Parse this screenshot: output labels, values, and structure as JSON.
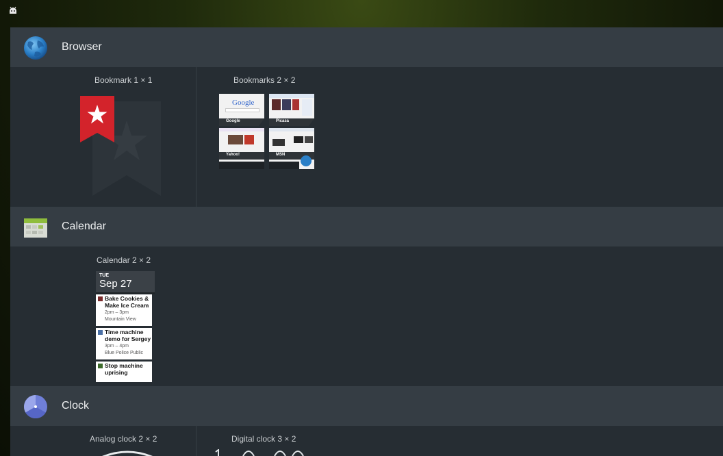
{
  "sections": {
    "browser": {
      "title": "Browser",
      "widgets": [
        {
          "label": "Bookmark 1 × 1"
        },
        {
          "label": "Bookmarks 2 × 2",
          "thumbs": [
            "Google",
            "Picasa",
            "Yahoo!",
            "MSN"
          ]
        }
      ]
    },
    "calendar": {
      "title": "Calendar",
      "widgets": [
        {
          "label": "Calendar 2 × 2",
          "day": "TUE",
          "date": "Sep 27",
          "events": [
            {
              "title": "Bake Cookies & Make Ice Cream",
              "time": "2pm – 3pm",
              "location": "Mountain View",
              "color": "#7a2b2b"
            },
            {
              "title": "Time machine demo for Sergey",
              "time": "3pm – 4pm",
              "location": "Blue Police Public",
              "color": "#4a6fa5"
            },
            {
              "title": "Stop machine uprising",
              "time": "",
              "location": "",
              "color": "#3d6b2b"
            }
          ]
        }
      ]
    },
    "clock": {
      "title": "Clock",
      "widgets": [
        {
          "label": "Analog clock 2 × 2"
        },
        {
          "label": "Digital clock 3 × 2"
        }
      ]
    }
  },
  "icons": {
    "status": "android-icon",
    "browser": "globe-icon",
    "calendar": "calendar-icon",
    "clock": "clock-icon",
    "bookmark": "bookmark-star-icon"
  },
  "colors": {
    "bookmark_red": "#d3232b",
    "header_bg": "#353d44",
    "panel_bg": "#262d33"
  }
}
